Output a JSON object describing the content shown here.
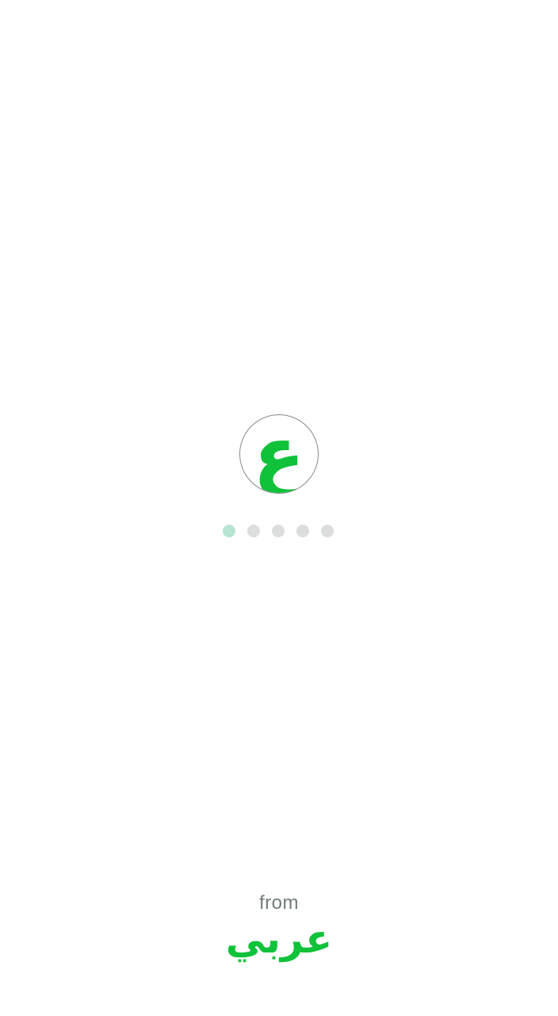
{
  "app": {
    "logo_glyph": "ع",
    "accent_color": "#10c23a"
  },
  "loading_indicator": {
    "total_dots": 5,
    "active_index": 0
  },
  "footer": {
    "from_label": "from",
    "brand_name": "عربي"
  }
}
